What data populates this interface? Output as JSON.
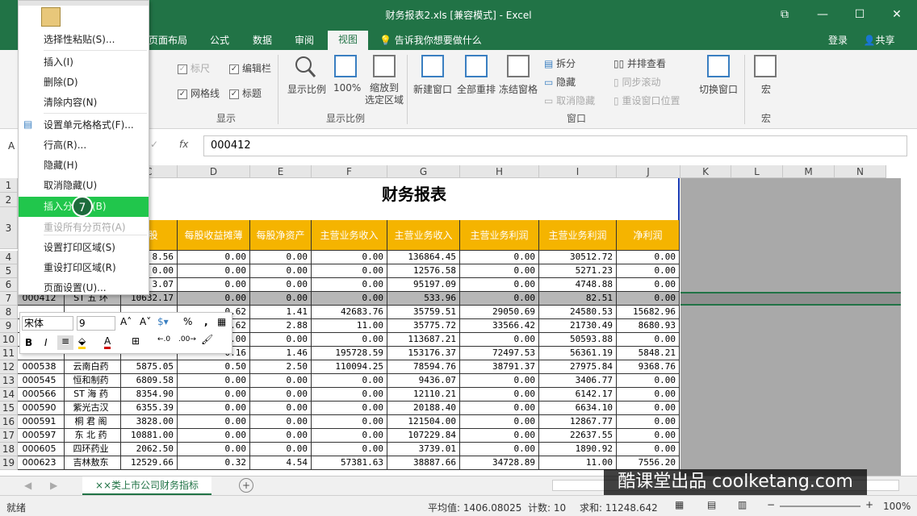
{
  "window": {
    "title": "财务报表2.xls  [兼容模式] - Excel",
    "minimize": "—",
    "maximize": "☐",
    "close": "✕",
    "ribbon_display": "⧉"
  },
  "tabs": [
    "页面布局",
    "公式",
    "数据",
    "审阅",
    "视图"
  ],
  "tell_me": "告诉我你想要做什么",
  "login": "登录",
  "share": "共享",
  "ribbon": {
    "show": {
      "ruler": "标尺",
      "formula_bar": "编辑栏",
      "gridlines": "网格线",
      "headings": "标题",
      "group": "显示"
    },
    "zoom": {
      "zoom": "显示比例",
      "hundred": "100%",
      "zoom_to_selection": "缩放到\n选定区域",
      "group": "显示比例"
    },
    "window": {
      "new_window": "新建窗口",
      "arrange_all": "全部重排",
      "freeze_panes": "冻结窗格",
      "split": "拆分",
      "hide": "隐藏",
      "unhide": "取消隐藏",
      "view_side": "并排查看",
      "sync_scroll": "同步滚动",
      "reset_pos": "重设窗口位置",
      "switch": "切换窗口",
      "group": "窗口"
    },
    "macros": {
      "label": "宏",
      "group": "宏"
    }
  },
  "formula_bar": {
    "name_box": "A",
    "fx": "fx",
    "value": "000412"
  },
  "context_menu": {
    "items": [
      {
        "label": "选择性粘贴(S)...",
        "disabled": false
      },
      {
        "label": "插入(I)",
        "disabled": false
      },
      {
        "label": "删除(D)",
        "disabled": false
      },
      {
        "label": "清除内容(N)",
        "disabled": false
      },
      {
        "label": "设置单元格格式(F)...",
        "disabled": false
      },
      {
        "label": "行高(R)...",
        "disabled": false
      },
      {
        "label": "隐藏(H)",
        "disabled": false
      },
      {
        "label": "取消隐藏(U)",
        "disabled": false
      },
      {
        "label": "插入分页符(B)",
        "disabled": false,
        "highlight": true
      },
      {
        "label": "重设所有分页符(A)",
        "disabled": true
      },
      {
        "label": "设置打印区域(S)",
        "disabled": false
      },
      {
        "label": "重设打印区域(R)",
        "disabled": false
      },
      {
        "label": "页面设置(U)...",
        "disabled": false
      }
    ],
    "step_badge": "7"
  },
  "mini_toolbar": {
    "font": "宋体",
    "size": "9",
    "bold": "B",
    "italic": "I",
    "percent": "%",
    "comma": ","
  },
  "columns": [
    "C",
    "D",
    "E",
    "F",
    "G",
    "H",
    "I",
    "J",
    "K",
    "L",
    "M",
    "N"
  ],
  "sheet_title": "财务报表",
  "headers": [
    "×股",
    "每股收益摊薄",
    "每股净资产",
    "主营业务收入",
    "主营业务收入",
    "主营业务利润",
    "主营业务利润",
    "净利润"
  ],
  "rows": [
    {
      "n": "4",
      "a": "",
      "b": "",
      "c": "8.56",
      "d": "0.00",
      "e": "0.00",
      "f": "0.00",
      "g": "136864.45",
      "h": "0.00",
      "i": "30512.72",
      "j": "0.00"
    },
    {
      "n": "5",
      "a": "",
      "b": "",
      "c": "0.00",
      "d": "0.00",
      "e": "0.00",
      "f": "0.00",
      "g": "12576.58",
      "h": "0.00",
      "i": "5271.23",
      "j": "0.00"
    },
    {
      "n": "6",
      "a": "",
      "b": "",
      "c": "3.07",
      "d": "0.00",
      "e": "0.00",
      "f": "0.00",
      "g": "95197.09",
      "h": "0.00",
      "i": "4748.88",
      "j": "0.00"
    },
    {
      "n": "7",
      "a": "000412",
      "b": "ST 五 环",
      "c": "10632.17",
      "d": "0.00",
      "e": "0.00",
      "f": "0.00",
      "g": "533.96",
      "h": "0.00",
      "i": "82.51",
      "j": "0.00"
    },
    {
      "n": "8",
      "a": "",
      "b": "",
      "c": "",
      "d": "0.62",
      "e": "1.41",
      "f": "42683.76",
      "g": "35759.51",
      "h": "29050.69",
      "i": "24580.53",
      "j": "15682.96"
    },
    {
      "n": "9",
      "a": "",
      "b": "",
      "c": "",
      "d": "0.62",
      "e": "2.88",
      "f": "11.00",
      "g": "35775.72",
      "h": "33566.42",
      "i": "21730.49",
      "j": "8680.93"
    },
    {
      "n": "10",
      "a": "",
      "b": "",
      "c": "",
      "d": "0.00",
      "e": "0.00",
      "f": "0.00",
      "g": "113687.21",
      "h": "0.00",
      "i": "50593.88",
      "j": "0.00"
    },
    {
      "n": "11",
      "a": "",
      "b": "",
      "c": "",
      "d": "0.16",
      "e": "1.46",
      "f": "195728.59",
      "g": "153176.37",
      "h": "72497.53",
      "i": "56361.19",
      "j": "5848.21"
    },
    {
      "n": "12",
      "a": "000538",
      "b": "云南白药",
      "c": "5875.05",
      "d": "0.50",
      "e": "2.50",
      "f": "110094.25",
      "g": "78594.76",
      "h": "38791.37",
      "i": "27975.84",
      "j": "9368.76"
    },
    {
      "n": "13",
      "a": "000545",
      "b": "恒和制药",
      "c": "6809.58",
      "d": "0.00",
      "e": "0.00",
      "f": "0.00",
      "g": "9436.07",
      "h": "0.00",
      "i": "3406.77",
      "j": "0.00"
    },
    {
      "n": "14",
      "a": "000566",
      "b": "ST 海 药",
      "c": "8354.90",
      "d": "0.00",
      "e": "0.00",
      "f": "0.00",
      "g": "12110.21",
      "h": "0.00",
      "i": "6142.17",
      "j": "0.00"
    },
    {
      "n": "15",
      "a": "000590",
      "b": "紫光古汉",
      "c": "6355.39",
      "d": "0.00",
      "e": "0.00",
      "f": "0.00",
      "g": "20188.40",
      "h": "0.00",
      "i": "6634.10",
      "j": "0.00"
    },
    {
      "n": "16",
      "a": "000591",
      "b": "桐 君 阁",
      "c": "3828.00",
      "d": "0.00",
      "e": "0.00",
      "f": "0.00",
      "g": "121504.00",
      "h": "0.00",
      "i": "12867.77",
      "j": "0.00"
    },
    {
      "n": "17",
      "a": "000597",
      "b": "东 北 药",
      "c": "10881.00",
      "d": "0.00",
      "e": "0.00",
      "f": "0.00",
      "g": "107229.84",
      "h": "0.00",
      "i": "22637.55",
      "j": "0.00"
    },
    {
      "n": "18",
      "a": "000605",
      "b": "四环药业",
      "c": "2062.50",
      "d": "0.00",
      "e": "0.00",
      "f": "0.00",
      "g": "3739.01",
      "h": "0.00",
      "i": "1890.92",
      "j": "0.00"
    },
    {
      "n": "19",
      "a": "000623",
      "b": "吉林敖东",
      "c": "12529.66",
      "d": "0.32",
      "e": "4.54",
      "f": "57381.63",
      "g": "38887.66",
      "h": "34728.89",
      "i": "11.00",
      "j": "7556.20"
    }
  ],
  "row_numbers_top": [
    "1",
    "2",
    "3"
  ],
  "sheet_tab": "××类上市公司财务指标",
  "status": {
    "ready": "就绪",
    "average": "平均值: 1406.08025",
    "count": "计数: 10",
    "sum": "求和: 11248.642",
    "zoom": "100%"
  },
  "watermark": "酷课堂出品 coolketang.com"
}
